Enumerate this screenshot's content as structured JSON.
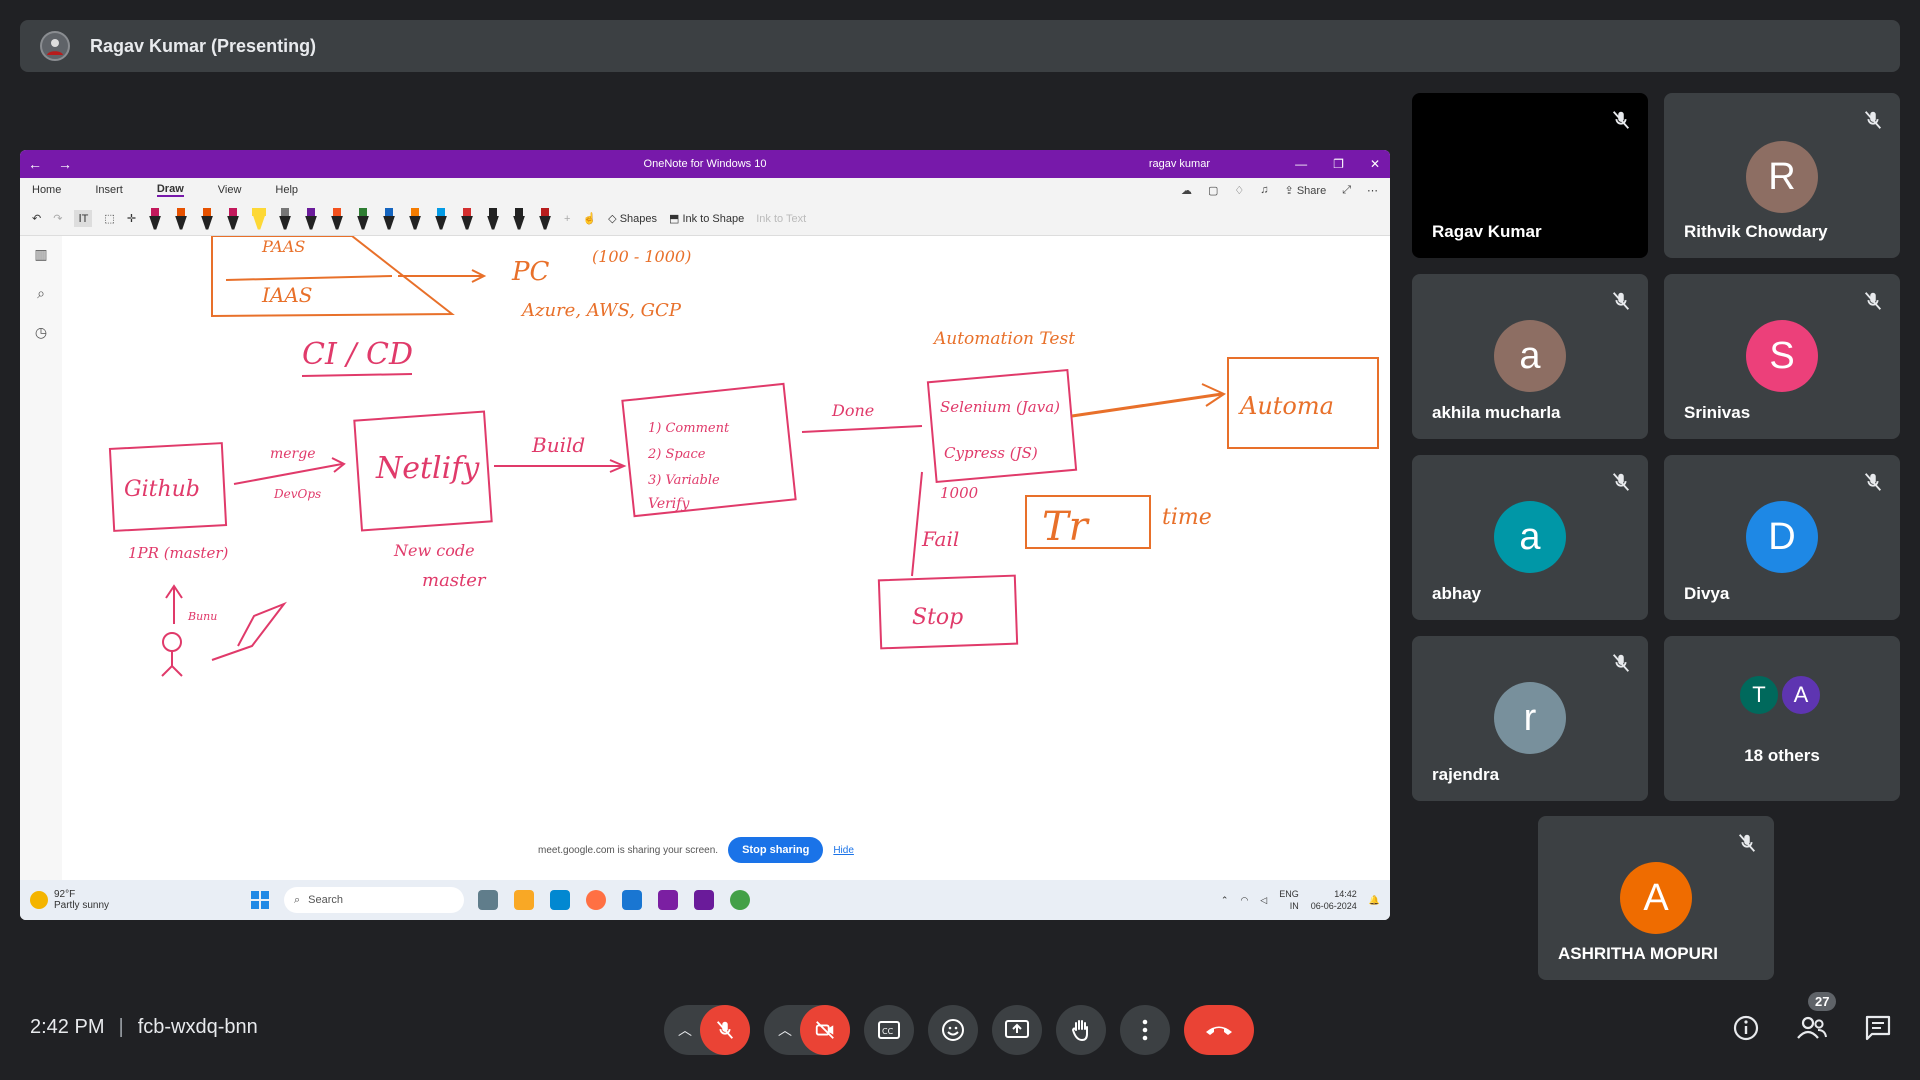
{
  "presenter": {
    "name": "Ragav Kumar (Presenting)"
  },
  "onenote": {
    "title": "OneNote for Windows 10",
    "user": "ragav kumar",
    "menu": [
      "Home",
      "Insert",
      "Draw",
      "View",
      "Help"
    ],
    "active_menu": "Draw",
    "share_label": "Share",
    "shapes_label": "Shapes",
    "ink_to_shape_label": "Ink to Shape",
    "ink_to_text_label": "Ink to Text"
  },
  "whiteboard": {
    "texts": [
      "PAAS",
      "IAAS",
      "PC",
      "(100 - 1000)",
      "Azure, AWS, GCP",
      "CI / CD",
      "Github",
      "merge",
      "DevOps",
      "Netlify",
      "New code",
      "master",
      "1PR (master)",
      "Build",
      "1) Comment",
      "2) Space",
      "3) Variable",
      "Verify",
      "Done",
      "Automation Test",
      "Selenium (Java)",
      "Cypress (JS)",
      "Automa",
      "1000",
      "Fail",
      "Stop",
      "Tr",
      "time",
      "Bunu"
    ]
  },
  "share_banner": {
    "message": "meet.google.com is sharing your screen.",
    "stop_label": "Stop sharing",
    "hide_label": "Hide"
  },
  "taskbar": {
    "temp": "92°F",
    "weather": "Partly sunny",
    "search_placeholder": "Search",
    "lang": "ENG",
    "region": "IN",
    "time": "14:42",
    "date": "06-06-2024"
  },
  "participants": [
    {
      "name": "Ragav Kumar",
      "initial": "",
      "color": "#000000"
    },
    {
      "name": "Rithvik Chowdary",
      "initial": "R",
      "color": "#8d6e63"
    },
    {
      "name": "akhila mucharla",
      "initial": "a",
      "color": "#8d6e63"
    },
    {
      "name": "Srinivas",
      "initial": "S",
      "color": "#ec407a"
    },
    {
      "name": "abhay",
      "initial": "a",
      "color": "#0097a7"
    },
    {
      "name": "Divya",
      "initial": "D",
      "color": "#1e88e5"
    },
    {
      "name": "rajendra",
      "initial": "r",
      "color": "#78909c"
    },
    {
      "name": "ASHRITHA MOPURI",
      "initial": "A",
      "color": "#ef6c00"
    }
  ],
  "others": {
    "label": "18 others",
    "initials": [
      "T",
      "A"
    ],
    "colors": [
      "#00695c",
      "#5e35b1"
    ]
  },
  "meeting": {
    "time": "2:42 PM",
    "code": "fcb-wxdq-bnn",
    "people_count": "27"
  }
}
